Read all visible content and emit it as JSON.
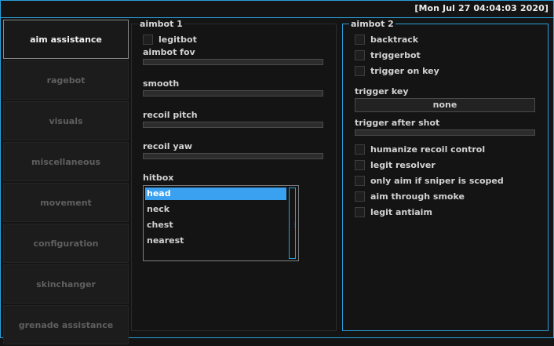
{
  "datetime": "[Mon Jul 27 04:04:03 2020]",
  "colors": {
    "accent": "#2a9fd8",
    "selected": "#3aa0f0",
    "background": "#141414"
  },
  "sidebar": {
    "items": [
      {
        "label": "aim assistance",
        "active": true
      },
      {
        "label": "ragebot"
      },
      {
        "label": "visuals"
      },
      {
        "label": "miscellaneous"
      },
      {
        "label": "movement"
      },
      {
        "label": "configuration"
      },
      {
        "label": "skinchanger"
      },
      {
        "label": "grenade assistance"
      }
    ]
  },
  "aimbot1": {
    "title": "aimbot 1",
    "legitbot": "legitbot",
    "fov_label": "aimbot fov",
    "smooth_label": "smooth",
    "recoil_pitch_label": "recoil pitch",
    "recoil_yaw_label": "recoil yaw",
    "hitbox_label": "hitbox",
    "hitbox_options": [
      "head",
      "neck",
      "chest",
      "nearest"
    ]
  },
  "aimbot2": {
    "title": "aimbot 2",
    "checkboxes_top": [
      "backtrack",
      "triggerbot",
      "trigger on key"
    ],
    "trigger_key_label": "trigger key",
    "trigger_key_value": "none",
    "trigger_after_shot_label": "trigger after shot",
    "checkboxes_bottom": [
      "humanize recoil control",
      "legit resolver",
      "only aim if sniper is scoped",
      "aim through smoke",
      "legit antiaim"
    ]
  }
}
